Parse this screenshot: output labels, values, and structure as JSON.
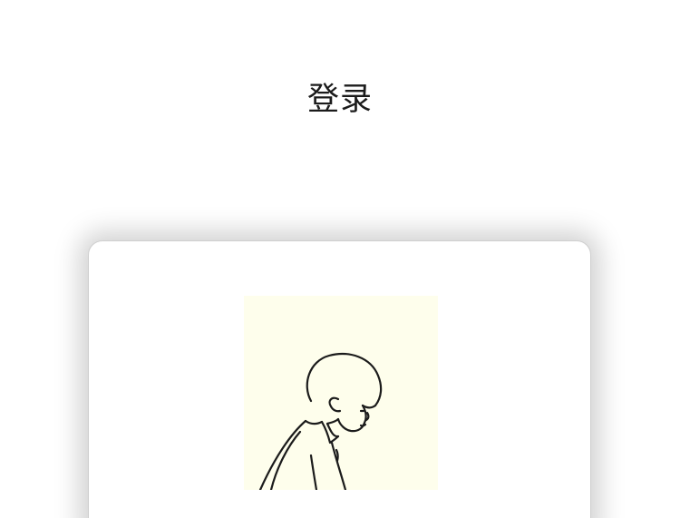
{
  "page": {
    "title": "登录"
  },
  "card": {
    "avatar": {
      "icon": "avatar-illustration",
      "background": "#fefeec",
      "line_color": "#1b1b1b"
    }
  }
}
